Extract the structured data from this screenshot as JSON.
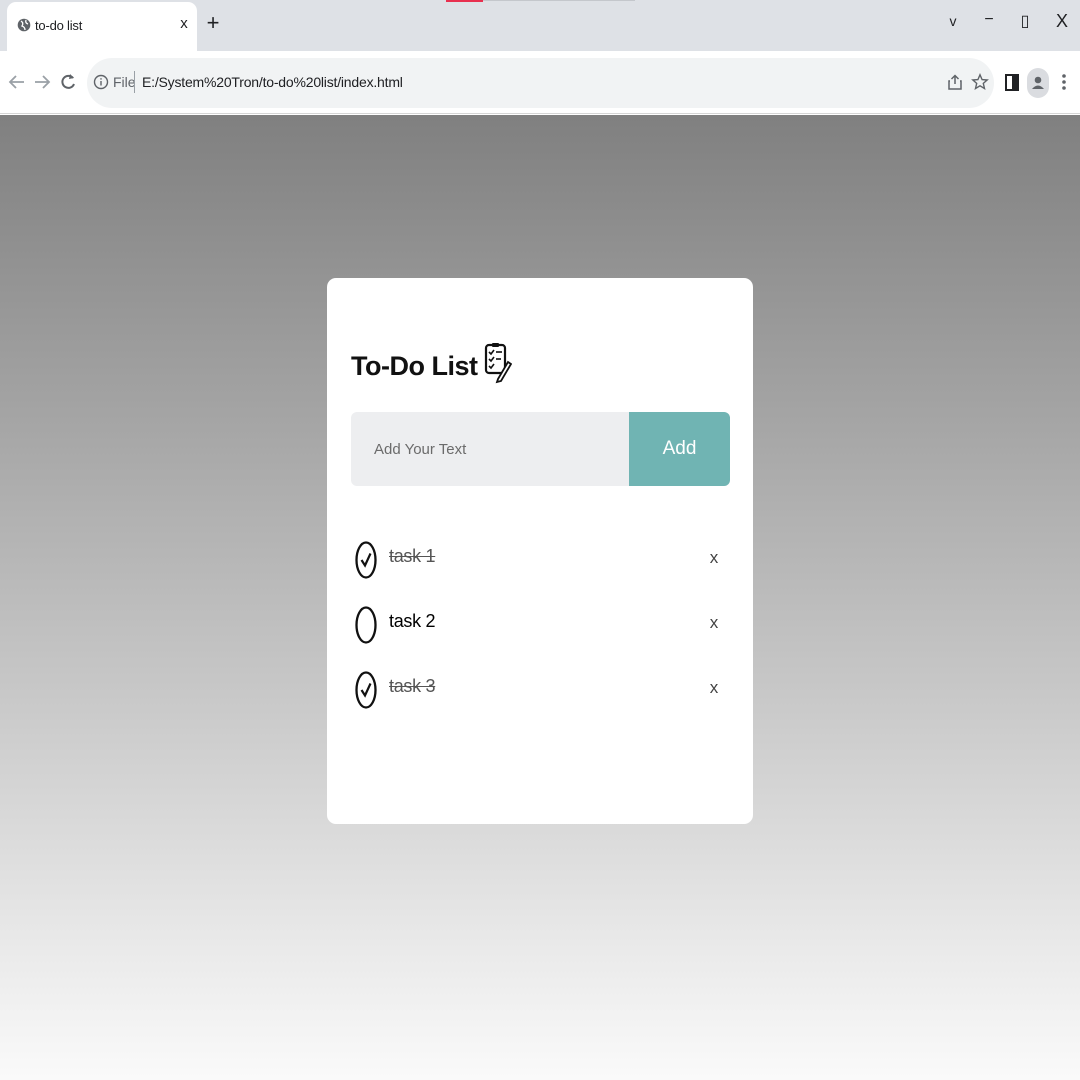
{
  "browser": {
    "tab_title": "to-do list",
    "tab_close": "x",
    "new_tab": "+",
    "window_controls": {
      "list_tabs": "v",
      "minimize": "−",
      "restore": "▯",
      "close": "X"
    },
    "address": {
      "scheme_label": "File",
      "url": "E:/System%20Tron/to-do%20list/index.html"
    },
    "icons": [
      "back-arrow-icon",
      "forward-arrow-icon",
      "reload-icon",
      "info-icon",
      "share-icon",
      "star-icon",
      "side-panel-icon",
      "profile-icon",
      "more-vert-icon"
    ]
  },
  "app": {
    "title": "To-Do List",
    "title_icon": "checklist-edit-icon",
    "input_placeholder": "Add Your Text",
    "add_label": "Add",
    "accent_color": "#70b4b3",
    "tasks": [
      {
        "text": "task 1",
        "done": true,
        "remove_label": "x"
      },
      {
        "text": "task 2",
        "done": false,
        "remove_label": "x"
      },
      {
        "text": "task 3",
        "done": true,
        "remove_label": "x"
      }
    ]
  }
}
